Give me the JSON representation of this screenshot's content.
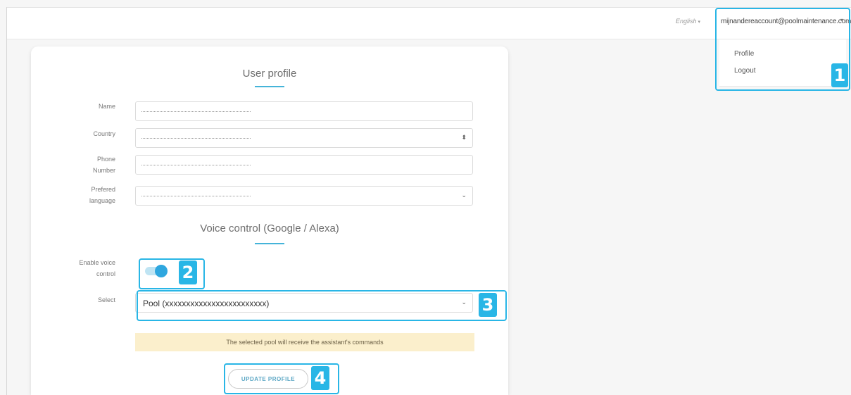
{
  "topbar": {
    "language": "English",
    "account_email": "mijnandereaccount@poolmaintenance.com"
  },
  "account_menu": {
    "items": [
      {
        "label": "Profile"
      },
      {
        "label": "Logout"
      }
    ]
  },
  "profile": {
    "title": "User profile",
    "fields": {
      "name_label": "Name",
      "country_label": "Country",
      "phone_label_line1": "Phone",
      "phone_label_line2": "Number",
      "language_label_line1": "Prefered",
      "language_label_line2": "language"
    }
  },
  "voice": {
    "title": "Voice control (Google / Alexa)",
    "enable_label_line1": "Enable voice",
    "enable_label_line2": "control",
    "enabled": true,
    "select_label": "Select",
    "selected_pool": "Pool (xxxxxxxxxxxxxxxxxxxxxxxx)",
    "notice": "The selected pool will receive the assistant's commands"
  },
  "update_button": "UPDATE PROFILE",
  "badges": [
    "1",
    "2",
    "3",
    "4"
  ],
  "colors": {
    "accent": "#29b6e6",
    "toggle_on": "#2fa7df",
    "notice_bg": "#fbefcc"
  },
  "icons": {
    "dropdown_caret": "chevron-down-icon",
    "country_select": "updown-arrows-icon"
  }
}
